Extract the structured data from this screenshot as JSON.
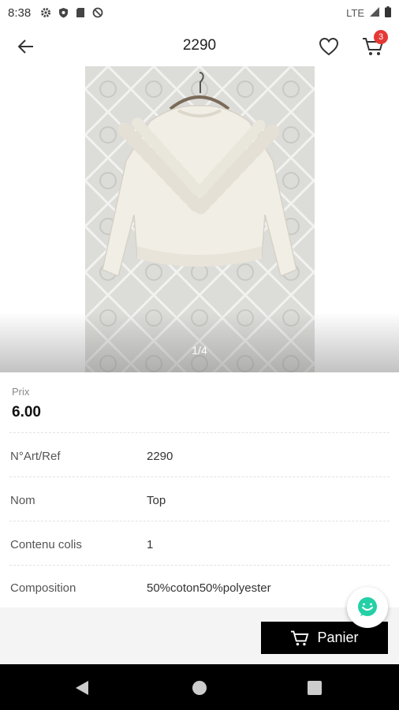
{
  "status_bar": {
    "time": "8:38",
    "network": "LTE"
  },
  "app_bar": {
    "title": "2290",
    "cart_count": "3"
  },
  "gallery": {
    "counter": "1/4"
  },
  "product": {
    "price_label": "Prix",
    "price_value": "6.00",
    "rows": [
      {
        "key": "N°Art/Ref",
        "value": "2290"
      },
      {
        "key": "Nom",
        "value": "Top"
      },
      {
        "key": "Contenu colis",
        "value": "1"
      },
      {
        "key": "Composition",
        "value": "50%coton50%polyester"
      }
    ]
  },
  "actions": {
    "panier_label": "Panier"
  },
  "colors": {
    "accent_black": "#000000",
    "badge_red": "#e53935",
    "chat_green": "#25d0a6"
  },
  "icons": [
    "back-arrow-icon",
    "heart-icon",
    "cart-icon",
    "chat-icon"
  ]
}
